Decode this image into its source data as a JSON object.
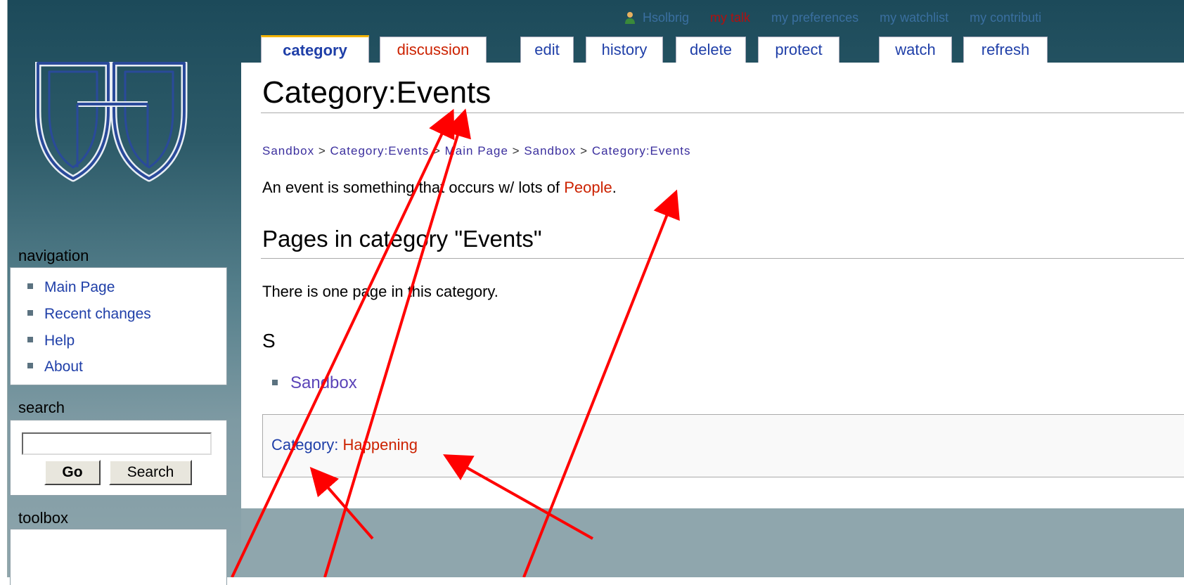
{
  "personal_bar": {
    "username": "Hsolbrig",
    "my_talk": "my talk",
    "my_preferences": "my preferences",
    "my_watchlist": "my watchlist",
    "my_contributions": "my contributi"
  },
  "tabs": [
    {
      "label": "category",
      "state": "selected"
    },
    {
      "label": "discussion",
      "state": "new"
    },
    {
      "label": "edit"
    },
    {
      "label": "history"
    },
    {
      "label": "delete"
    },
    {
      "label": "protect"
    },
    {
      "label": "watch"
    },
    {
      "label": "refresh"
    }
  ],
  "sidebar": {
    "navigation_title": "navigation",
    "navigation_items": [
      "Main Page",
      "Recent changes",
      "Help",
      "About"
    ],
    "search_title": "search",
    "search_value": "",
    "go_label": "Go",
    "search_label": "Search",
    "toolbox_title": "toolbox"
  },
  "content": {
    "title": "Category:Events",
    "breadcrumb": [
      "Sandbox",
      "Category:Events",
      "Main Page",
      "Sandbox",
      "Category:Events"
    ],
    "breadcrumb_separator": ">",
    "intro_text": "An event is something that occurs w/ lots of",
    "intro_link": "People",
    "intro_end": ".",
    "pages_heading": "Pages in category \"Events\"",
    "page_count_text": "There is one page in this category.",
    "letter": "S",
    "pages": [
      "Sandbox"
    ],
    "catlinks_label": "Category:",
    "catlinks_value": "Happening"
  },
  "colors": {
    "link": "#1f3fa8",
    "redlink": "#cc2200",
    "annotation_arrow": "#ff0000",
    "selected_tab_accent": "#f4b400"
  }
}
